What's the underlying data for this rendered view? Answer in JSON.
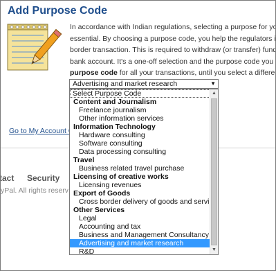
{
  "dialog": {
    "title": "Add Purpose Code",
    "paragraph_lines": [
      "In accordance with Indian regulations, selecting a purpose for your tra",
      "essential. By choosing a purpose code, you help the regulators in iden",
      "border transaction. This is required to withdraw (or transfer) funds from",
      "bank account. It's a one-off selection and the purpose code you add is s"
    ],
    "paragraph_last_bold": "purpose code",
    "paragraph_last_rest": " for all your transactions, until you select a different one."
  },
  "select": {
    "value": "Advertising and market research",
    "arrow": "▼"
  },
  "options": [
    {
      "type": "placeholder",
      "label": "Select Purpose Code"
    },
    {
      "type": "group",
      "label": "Content and Journalism"
    },
    {
      "type": "item",
      "label": "Freelance journalism"
    },
    {
      "type": "item",
      "label": "Other information services"
    },
    {
      "type": "group",
      "label": "Information Technology"
    },
    {
      "type": "item",
      "label": "Hardware consulting"
    },
    {
      "type": "item",
      "label": "Software consulting"
    },
    {
      "type": "item",
      "label": "Data processing consulting"
    },
    {
      "type": "group",
      "label": "Travel"
    },
    {
      "type": "item",
      "label": "Business related travel purchase"
    },
    {
      "type": "group",
      "label": "Licensing of creative works"
    },
    {
      "type": "item",
      "label": "Licensing revenues"
    },
    {
      "type": "group",
      "label": "Export of Goods"
    },
    {
      "type": "item",
      "label": "Cross border delivery of goods and services"
    },
    {
      "type": "group",
      "label": "Other Services"
    },
    {
      "type": "item",
      "label": "Legal"
    },
    {
      "type": "item",
      "label": "Accounting and tax"
    },
    {
      "type": "item",
      "label": "Business and Management Consultancy"
    },
    {
      "type": "item",
      "label": "Advertising and market research",
      "selected": true
    },
    {
      "type": "item",
      "label": "R&D"
    }
  ],
  "page": {
    "goto_link": "Go to My Account Ov",
    "footer_contact": "tact",
    "footer_security": "Security",
    "copyright": "yPal. All rights reserv"
  },
  "icons": {
    "notepad": "notepad-pencil-icon",
    "scroll_up": "chevron-up-icon",
    "scroll_down": "chevron-down-icon"
  },
  "colors": {
    "title": "#1f4e8c",
    "selection": "#3399ff"
  }
}
